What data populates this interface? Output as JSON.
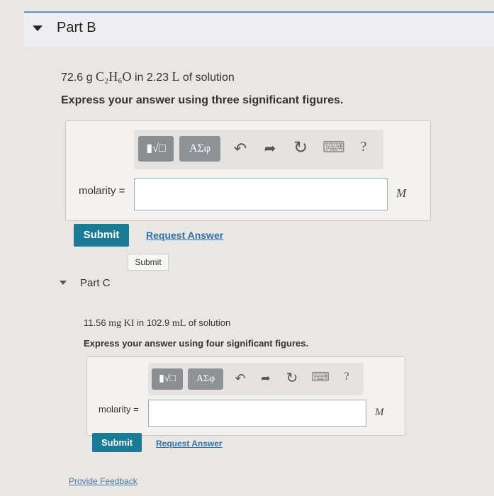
{
  "partB": {
    "title": "Part B",
    "question_mass": "72.6 g",
    "question_formula": "C₂H₆O",
    "question_middle": " in 2.23 ",
    "question_unit": "L",
    "question_tail": " of solution",
    "instruction": "Express your answer using three significant figures.",
    "answer_label": "molarity =",
    "answer_value": "",
    "unit": "M",
    "submit_label": "Submit",
    "request_label": "Request Answer"
  },
  "tooltip": "Submit",
  "toolbar": {
    "templates_label": "▮√□",
    "greek_label": "ΑΣφ",
    "undo_icon": "↶",
    "redo_icon": "➦",
    "reset_icon": "↻",
    "keyboard_icon": "⌨",
    "help_label": "?"
  },
  "partC": {
    "title": "Part C",
    "question_mass": "11.56 ",
    "question_mass_unit": "mg",
    "question_compound": " KI",
    "question_middle": " in 102.9 ",
    "question_unit": "mL",
    "question_tail": " of solution",
    "instruction": "Express your answer using four significant figures.",
    "answer_label": "molarity =",
    "answer_value": "",
    "unit": "M",
    "submit_label": "Submit",
    "request_label": "Request Answer"
  },
  "feedback_label": "Provide Feedback"
}
